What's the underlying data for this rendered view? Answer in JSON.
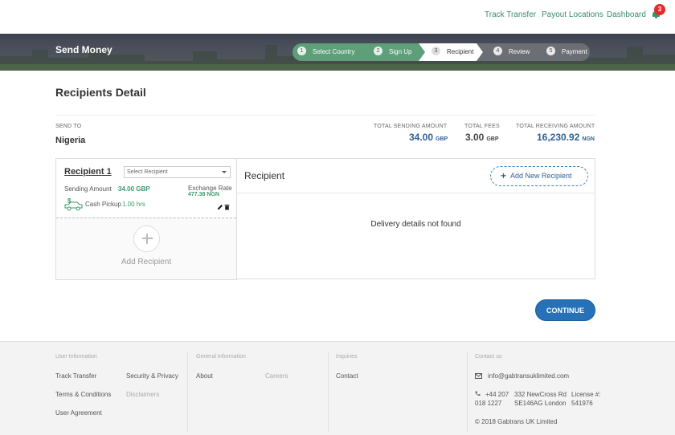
{
  "nav": {
    "track_transfer": "Track Transfer",
    "payout_locations": "Payout Locations",
    "dashboard": "Dashboard",
    "notification_count": "3"
  },
  "banner": {
    "title": "Send Money",
    "steps": [
      {
        "num": "1",
        "label": "Select Country",
        "state": "done"
      },
      {
        "num": "2",
        "label": "Sign Up",
        "state": "done"
      },
      {
        "num": "3",
        "label": "Recipient",
        "state": "current"
      },
      {
        "num": "4",
        "label": "Review",
        "state": "todo"
      },
      {
        "num": "5",
        "label": "Payment",
        "state": "todo"
      }
    ]
  },
  "page_title": "Recipients Detail",
  "summary": {
    "send_to_label": "SEND TO",
    "country": "Nigeria",
    "total_sending_label": "TOTAL SENDING AMOUNT",
    "total_sending_value": "34.00",
    "total_sending_currency": "GBP",
    "total_fees_label": "TOTAL FEES",
    "total_fees_value": "3.00",
    "total_fees_currency": "GBP",
    "total_receiving_label": "TOTAL RECEIVING AMOUNT",
    "total_receiving_value": "16,230.92",
    "total_receiving_currency": "NGN"
  },
  "recipient_card": {
    "name": "Recipient 1",
    "select_placeholder": "Select Recipient",
    "sending_amount_label": "Sending Amount",
    "sending_amount_value": "34.00 GBP",
    "exchange_rate_label": "Exchange Rate",
    "exchange_rate_value": "477.38 NGN",
    "payout_method": "Cash Pickup",
    "payout_time": "1.00 hrs",
    "add_recipient_label": "Add Recipient"
  },
  "recipient_panel": {
    "title": "Recipient",
    "add_new_label": "Add New Recipient",
    "empty_message": "Delivery details not found"
  },
  "continue_label": "CONTINUE",
  "footer": {
    "user_info_heading": "User Information",
    "general_info_heading": "General Information",
    "inquiries_heading": "Inquiries",
    "contact_heading": "Contact us",
    "track_transfer": "Track Transfer",
    "security_privacy": "Security & Privacy",
    "terms": "Terms & Conditions",
    "disclaimers": "Disclaimers",
    "user_agreement": "User Agreement",
    "about": "About",
    "careers": "Careers",
    "contact": "Contact",
    "email": "info@gabtransuklimited.com",
    "phone_line1": "+44 207",
    "phone_line2": "018 1227",
    "address_line1": "332 NewCross Rd",
    "address_line2": "SE146AG London",
    "license_line1": "License #:",
    "license_line2": "541976",
    "copyright": "© 2018 Gabtrans UK Limited"
  },
  "colors": {
    "accent_green": "#3a8a6a",
    "step_done": "#5e9f79",
    "step_current": "#ffffff",
    "step_todo": "#6b6f74",
    "primary_blue": "#2671b8",
    "amount_blue": "#2d5f96",
    "badge_red": "#e42b2b"
  }
}
